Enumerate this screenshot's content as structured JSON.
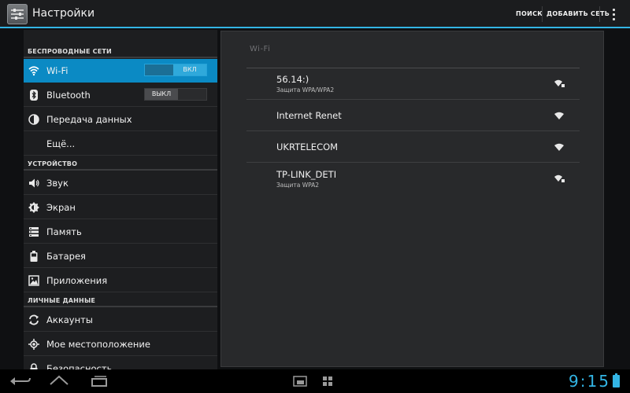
{
  "action_bar": {
    "title": "Настройки",
    "search_label": "ПОИСК",
    "add_network_label": "ДОБАВИТЬ СЕТЬ",
    "icon": "settings-sliders-icon",
    "overflow_icon": "overflow-menu-icon"
  },
  "sidebar": {
    "sections": [
      {
        "label": "БЕСПРОВОДНЫЕ СЕТИ"
      },
      {
        "label": "УСТРОЙСТВО"
      },
      {
        "label": "ЛИЧНЫЕ ДАННЫЕ"
      }
    ],
    "items": [
      {
        "label": "Wi-Fi",
        "icon": "wifi-icon",
        "toggle": "ВКЛ"
      },
      {
        "label": "Bluetooth",
        "icon": "bluetooth-icon",
        "toggle": "ВЫКЛ"
      },
      {
        "label": "Передача данных",
        "icon": "data-usage-icon"
      },
      {
        "label": "Ещё..."
      },
      {
        "label": "Звук",
        "icon": "sound-icon"
      },
      {
        "label": "Экран",
        "icon": "display-icon"
      },
      {
        "label": "Память",
        "icon": "storage-icon"
      },
      {
        "label": "Батарея",
        "icon": "battery-icon"
      },
      {
        "label": "Приложения",
        "icon": "apps-icon"
      },
      {
        "label": "Аккаунты",
        "icon": "accounts-sync-icon"
      },
      {
        "label": "Мое местоположение",
        "icon": "location-icon"
      },
      {
        "label": "Безопасность",
        "icon": "lock-icon"
      }
    ]
  },
  "wifi_panel": {
    "header": "Wi-Fi",
    "networks": [
      {
        "ssid": "56.14:)",
        "security": "Защита WPA/WPA2",
        "icon": "wifi-signal-locked-icon"
      },
      {
        "ssid": "Internet Renet",
        "security": "",
        "icon": "wifi-signal-icon"
      },
      {
        "ssid": "UKRTELECOM",
        "security": "",
        "icon": "wifi-signal-icon"
      },
      {
        "ssid": "TP-LINK_DETI",
        "security": "Защита WPA2",
        "icon": "wifi-signal-locked-icon"
      }
    ]
  },
  "nav_bar": {
    "clock": "9:15",
    "accent_color": "#33b5e5"
  }
}
